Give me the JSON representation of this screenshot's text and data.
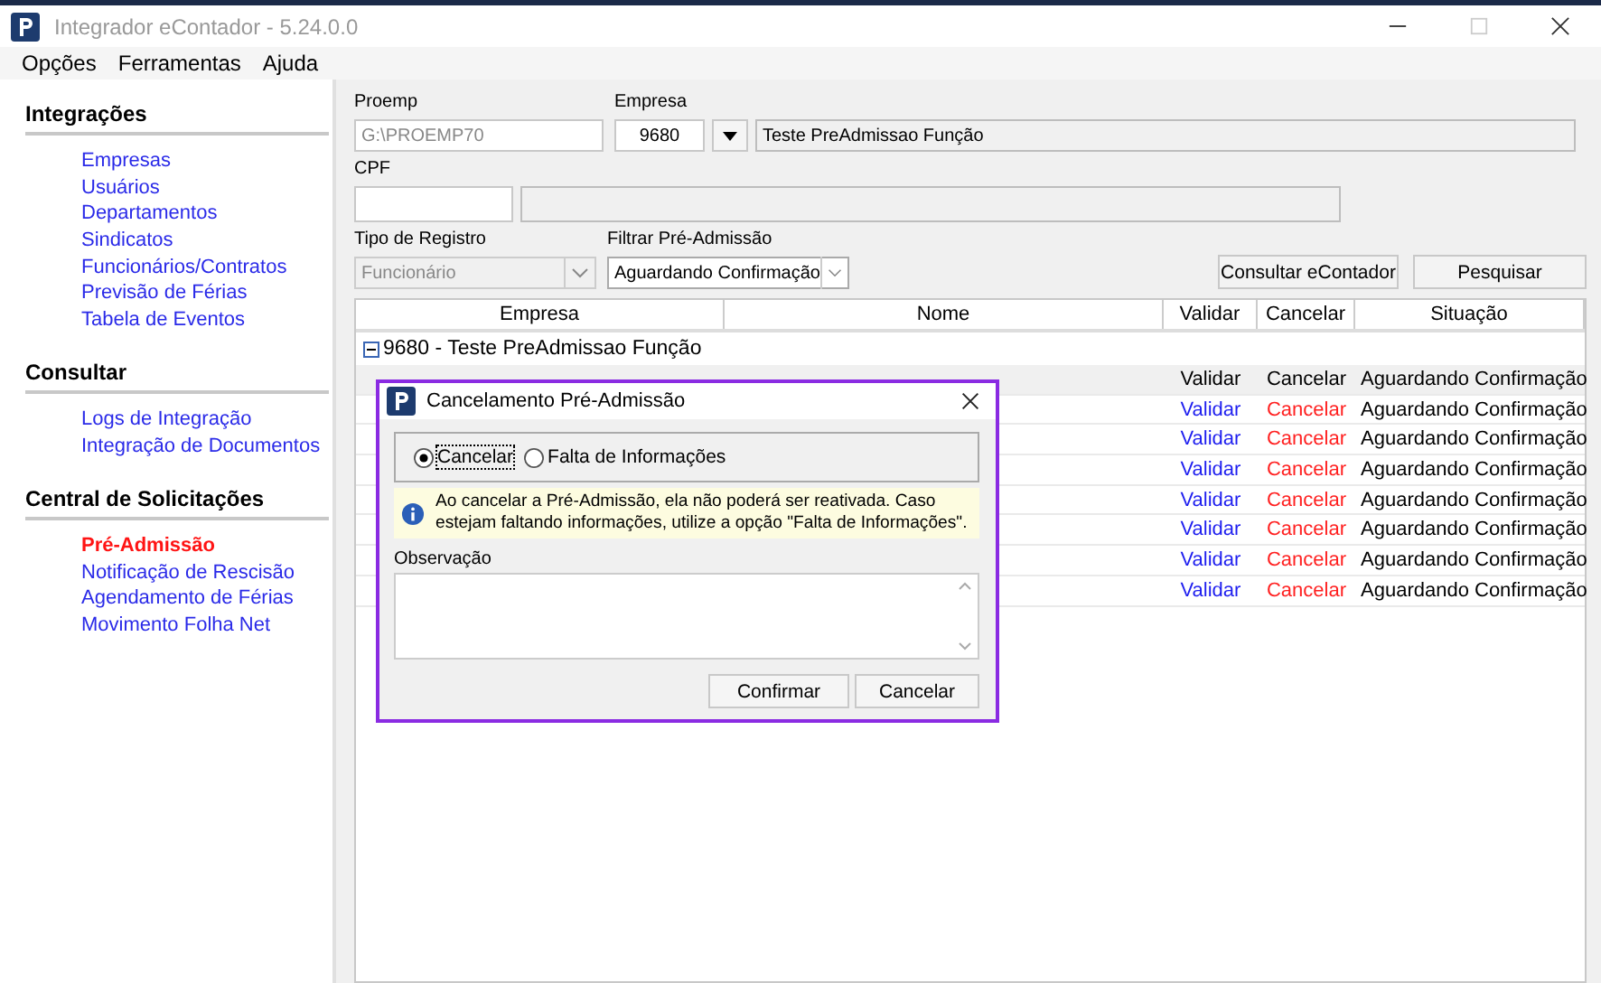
{
  "window": {
    "title": "Integrador eContador - 5.24.0.0"
  },
  "menu": [
    "Opções",
    "Ferramentas",
    "Ajuda"
  ],
  "sidebar": {
    "sections": [
      {
        "title": "Integrações",
        "items": [
          {
            "label": "Empresas",
            "selected": false
          },
          {
            "label": "Usuários",
            "selected": false
          },
          {
            "label": "Departamentos",
            "selected": false
          },
          {
            "label": "Sindicatos",
            "selected": false
          },
          {
            "label": "Funcionários/Contratos",
            "selected": false
          },
          {
            "label": "Previsão de Férias",
            "selected": false
          },
          {
            "label": "Tabela de Eventos",
            "selected": false
          }
        ]
      },
      {
        "title": "Consultar",
        "items": [
          {
            "label": "Logs de Integração",
            "selected": false
          },
          {
            "label": "Integração de Documentos",
            "selected": false
          }
        ]
      },
      {
        "title": "Central de Solicitações",
        "items": [
          {
            "label": "Pré-Admissão",
            "selected": true
          },
          {
            "label": "Notificação de Rescisão",
            "selected": false
          },
          {
            "label": "Agendamento de Férias",
            "selected": false
          },
          {
            "label": "Movimento Folha Net",
            "selected": false
          }
        ]
      }
    ]
  },
  "form": {
    "proemp": {
      "label": "Proemp",
      "value": "G:\\PROEMP70"
    },
    "empresa": {
      "label": "Empresa",
      "code": "9680",
      "name": "Teste PreAdmissao Função"
    },
    "cpf": {
      "label": "CPF"
    },
    "tipo_registro": {
      "label": "Tipo de Registro",
      "value": "Funcionário",
      "disabled": true
    },
    "filtro": {
      "label": "Filtrar Pré-Admissão",
      "value": "Aguardando Confirmação",
      "disabled": false
    },
    "buttons": [
      "Consultar eContador",
      "Pesquisar"
    ]
  },
  "table": {
    "columns": [
      "Empresa",
      "Nome",
      "Validar",
      "Cancelar",
      "Situação"
    ],
    "group": {
      "label": "9680 - Teste PreAdmissao Função",
      "expanded": true
    },
    "rows": [
      {
        "validar": "Validar",
        "cancelar": "Cancelar",
        "situacao": "Aguardando Confirmação",
        "selected": true
      },
      {
        "validar": "Validar",
        "cancelar": "Cancelar",
        "situacao": "Aguardando Confirmação",
        "selected": false
      },
      {
        "validar": "Validar",
        "cancelar": "Cancelar",
        "situacao": "Aguardando Confirmação",
        "selected": false
      },
      {
        "validar": "Validar",
        "cancelar": "Cancelar",
        "situacao": "Aguardando Confirmação",
        "selected": false
      },
      {
        "validar": "Validar",
        "cancelar": "Cancelar",
        "situacao": "Aguardando Confirmação",
        "selected": false
      },
      {
        "validar": "Validar",
        "cancelar": "Cancelar",
        "situacao": "Aguardando Confirmação",
        "selected": false
      },
      {
        "validar": "Validar",
        "cancelar": "Cancelar",
        "situacao": "Aguardando Confirmação",
        "selected": false
      },
      {
        "validar": "Validar",
        "cancelar": "Cancelar",
        "situacao": "Aguardando Confirmação",
        "selected": false
      }
    ]
  },
  "dialog": {
    "title": "Cancelamento Pré-Admissão",
    "options": [
      {
        "label": "Cancelar",
        "selected": true
      },
      {
        "label": "Falta de Informações",
        "selected": false
      }
    ],
    "info": "Ao cancelar a Pré-Admissão, ela não poderá ser reativada. Caso estejam faltando informações, utilize a opção \"Falta de Informações\".",
    "observacao_label": "Observação",
    "buttons": [
      "Confirmar",
      "Cancelar"
    ]
  }
}
